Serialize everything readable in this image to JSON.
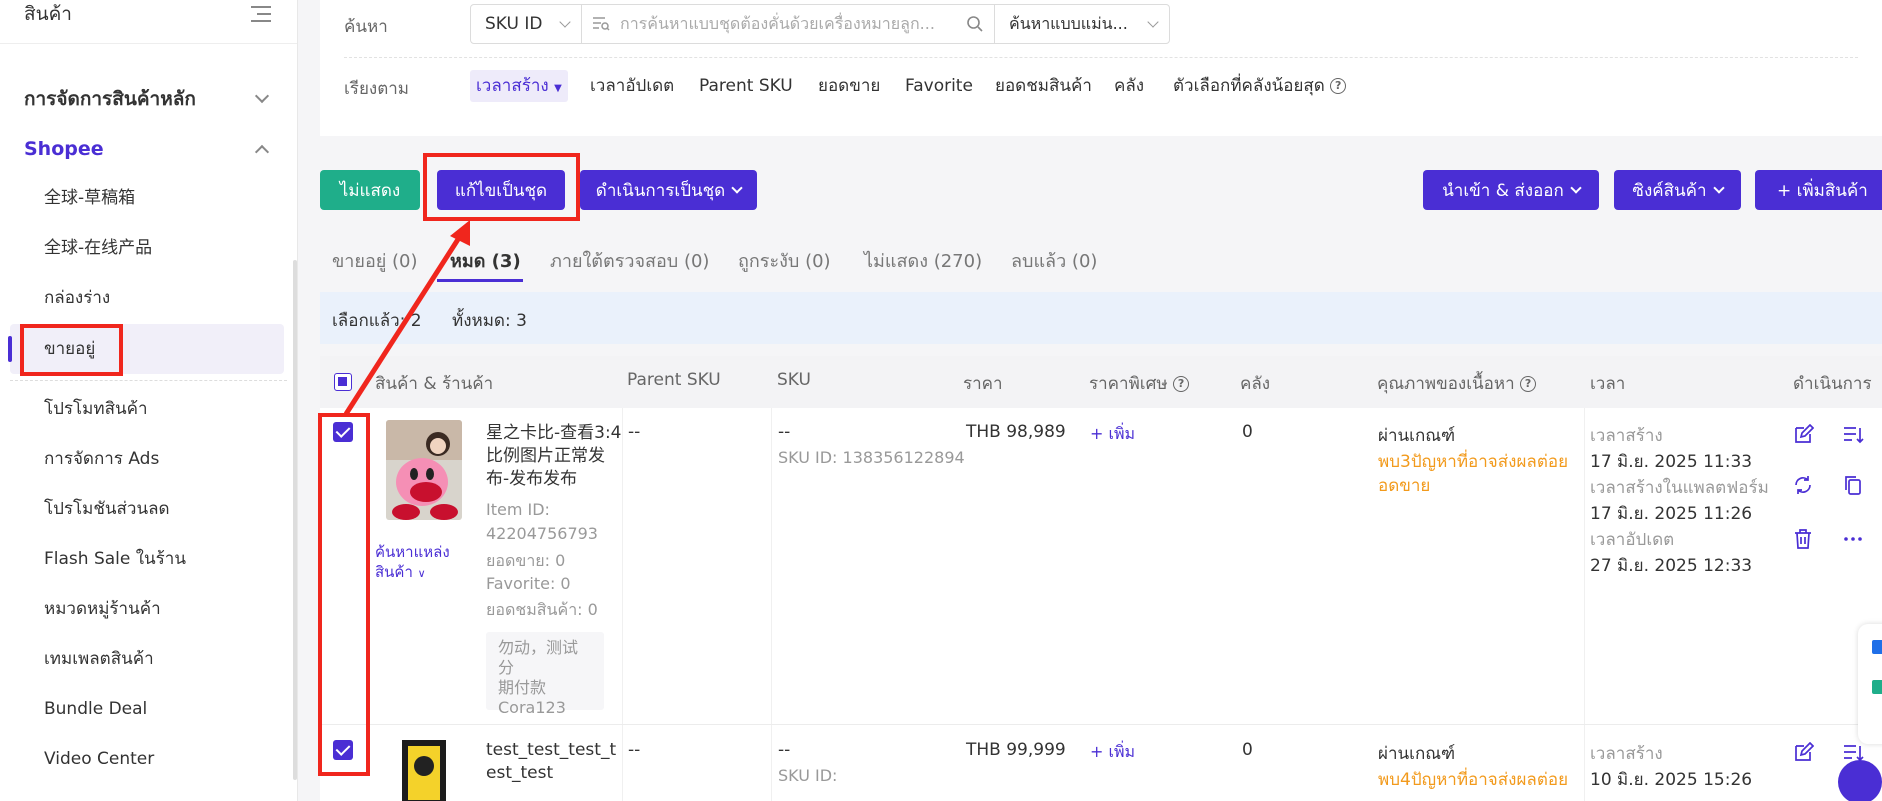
{
  "sidebar": {
    "title": "สินค้า",
    "section_main": "การจัดการสินค้าหลัก",
    "section_shopee": "Shopee",
    "items": [
      {
        "label": "全球-草稿箱"
      },
      {
        "label": "全球-在线产品"
      },
      {
        "label": "กล่องร่าง"
      },
      {
        "label": "ขายอยู่"
      },
      {
        "label": "โปรโมทสินค้า"
      },
      {
        "label": "การจัดการ Ads"
      },
      {
        "label": "โปรโมชันส่วนลด"
      },
      {
        "label": "Flash Sale ในร้าน"
      },
      {
        "label": "หมวดหมู่ร้านค้า"
      },
      {
        "label": "เทมเพลตสินค้า"
      },
      {
        "label": "Bundle Deal"
      },
      {
        "label": "Video Center"
      }
    ]
  },
  "filter": {
    "search_label": "ค้นหา",
    "sku_select": "SKU ID",
    "search_placeholder": "การค้นหาแบบชุดต้องคั่นด้วยเครื่องหมายลูก...",
    "mode_select": "ค้นหาแบบแม่น...",
    "sort_label": "เรียงตาม",
    "sort_options": [
      "เวลาสร้าง",
      "เวลาอัปเดต",
      "Parent SKU",
      "ยอดขาย",
      "Favorite",
      "ยอดชมสินค้า",
      "คลัง",
      "ตัวเลือกที่คลังน้อยสุด"
    ]
  },
  "actions": {
    "hide": "ไม่แสดง",
    "batch_edit": "แก้ไขเป็นชุด",
    "batch_action": "ดำเนินการเป็นชุด",
    "import_export": "นำเข้า & ส่งออก",
    "sync": "ซิงค์สินค้า",
    "add": "+ เพิ่มสินค้า"
  },
  "tabs": [
    {
      "label": "ขายอยู่ (0)"
    },
    {
      "label": "หมด (3)"
    },
    {
      "label": "ภายใต้ตรวจสอบ (0)"
    },
    {
      "label": "ถูกระงับ (0)"
    },
    {
      "label": "ไม่แสดง (270)"
    },
    {
      "label": "ลบแล้ว (0)"
    }
  ],
  "selection": {
    "selected": "เลือกแล้ว: 2",
    "total": "ทั้งหมด: 3"
  },
  "table": {
    "headers": {
      "product": "สินค้า & ร้านค้า",
      "parent_sku": "Parent SKU",
      "sku": "SKU",
      "price": "ราคา",
      "special_price": "ราคาพิเศษ",
      "stock": "คลัง",
      "quality": "คุณภาพของเนื้อหา",
      "time": "เวลา",
      "actions": "ดำเนินการ"
    },
    "rows": [
      {
        "title_lines": [
          "星之卡比-查看3:4",
          "比例图片正常发",
          "布-发布发布"
        ],
        "item_id_label": "Item ID:",
        "item_id": "42204756793",
        "sales": "ยอดขาย: 0",
        "favorite": "Favorite: 0",
        "views": "ยอดชมสินค้า: 0",
        "find_source_1": "ค้นหาแหล่ง",
        "find_source_2": "สินค้า",
        "tag_lines": [
          "勿动，测试分",
          "期付款",
          "Cora123"
        ],
        "parent_sku": "--",
        "sku": "--",
        "sku_id": "SKU ID: 138356122894",
        "price": "THB 98,989",
        "special": "+ เพิ่ม",
        "stock": "0",
        "quality": "ผ่านเกณฑ์",
        "quality_warn_1": "พบ3ปัญหาที่อาจส่งผลต่อย",
        "quality_warn_2": "อดขาย",
        "created_label": "เวลาสร้าง",
        "created": "17 มิ.ย. 2025 11:33",
        "platform_created_label": "เวลาสร้างในแพลตฟอร์ม",
        "platform_created": "17 มิ.ย. 2025 11:26",
        "updated_label": "เวลาอัปเดต",
        "updated": "27 มิ.ย. 2025 12:33"
      },
      {
        "title_lines": [
          "test_test_test_t",
          "est_test"
        ],
        "parent_sku": "--",
        "sku": "--",
        "sku_id": "SKU ID:",
        "price": "THB 99,999",
        "special": "+ เพิ่ม",
        "stock": "0",
        "quality": "ผ่านเกณฑ์",
        "quality_warn_1": "พบ4ปัญหาที่อาจส่งผลต่อย",
        "created_label": "เวลาสร้าง",
        "created": "10 มิ.ย. 2025 15:26"
      }
    ]
  },
  "colors": {
    "accent": "#4a2ed4",
    "green": "#1fae8a",
    "warning": "#f29a1c",
    "annotation": "#f0261d"
  }
}
